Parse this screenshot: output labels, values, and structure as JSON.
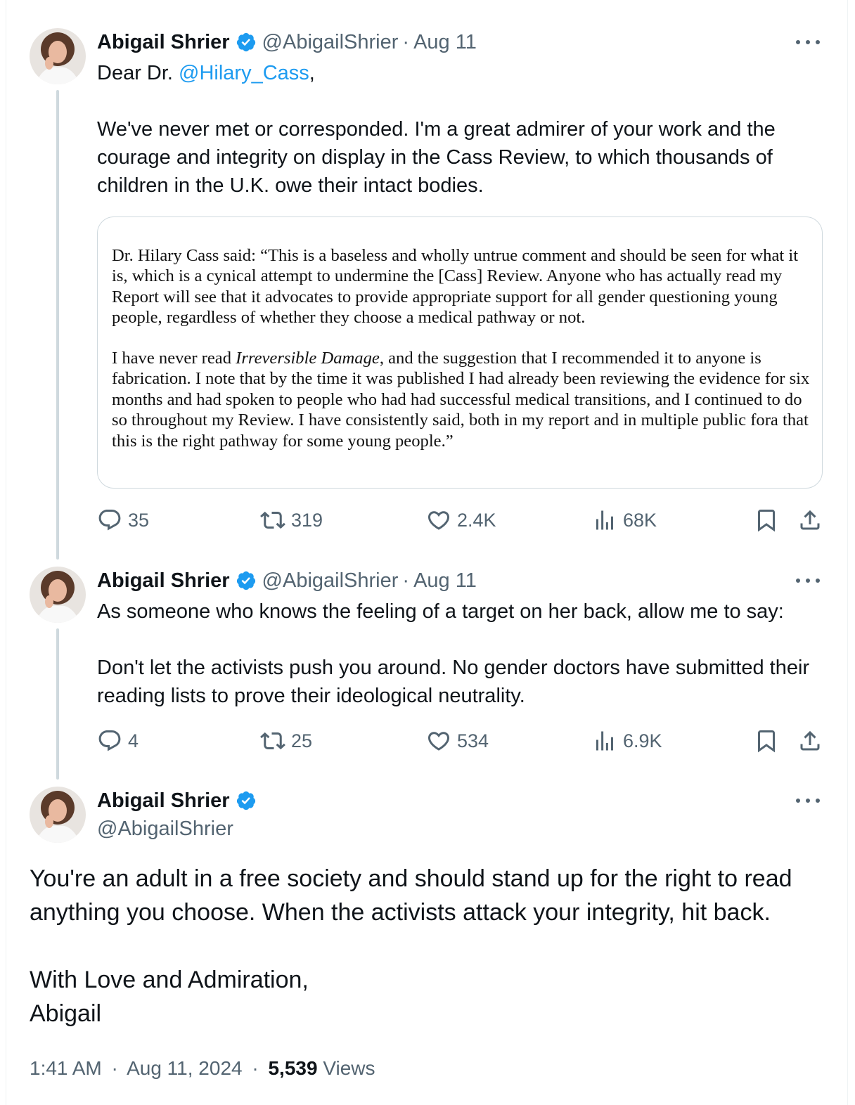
{
  "tweets": [
    {
      "name": "Abigail Shrier",
      "handle": "@AbigailShrier",
      "date": "Aug 11",
      "text_prefix": "Dear Dr. ",
      "mention": "@Hilary_Cass",
      "text_after_mention": ",",
      "text_body": "We've never met or corresponded. I'm a great admirer of your work and the courage and integrity on display in the Cass Review, to which thousands of children in the U.K. owe their intact bodies.",
      "quote": {
        "para1": "Dr. Hilary Cass said: “This is a baseless and wholly untrue comment and should be seen for what it is, which is a cynical attempt to undermine the [Cass] Review. Anyone who has actually read my Report will see that it advocates to provide appropriate support for all gender questioning young people, regardless of whether they choose a medical pathway or not.",
        "para2_before": "I have never read ",
        "para2_italic": "Irreversible Damage",
        "para2_after": ", and the suggestion that I recommended it to anyone is fabrication. I note that by the time it was published I had already been reviewing the evidence for six months and had spoken to people who had had successful medical transitions, and I continued to do so throughout my Review. I have consistently said, both in my report and in multiple public fora that this is the right pathway for some young people.”"
      },
      "stats": {
        "replies": "35",
        "reposts": "319",
        "likes": "2.4K",
        "views": "68K"
      }
    },
    {
      "name": "Abigail Shrier",
      "handle": "@AbigailShrier",
      "date": "Aug 11",
      "text_line1": "As someone who knows the feeling of a target on her back, allow me to say:",
      "text_body": "Don't let the activists push you around. No gender doctors have submitted their reading lists to prove their ideological neutrality.",
      "stats": {
        "replies": "4",
        "reposts": "25",
        "likes": "534",
        "views": "6.9K"
      }
    }
  ],
  "main_tweet": {
    "name": "Abigail Shrier",
    "handle": "@AbigailShrier",
    "text": "You're an adult in a free society and should stand up for the right to read anything you choose. When the activists attack your integrity, hit back.\n\nWith Love and Admiration,\nAbigail",
    "time": "1:41 AM",
    "date": "Aug 11, 2024",
    "views_count": "5,539",
    "views_label": "Views"
  },
  "separator": "·",
  "colors": {
    "text": "#0f1419",
    "secondary": "#536471",
    "link": "#1d9bf0",
    "verified": "#1d9bf0",
    "border": "#cfd9de"
  },
  "icons": [
    "verified-badge-icon",
    "more-icon",
    "reply-icon",
    "repost-icon",
    "like-icon",
    "views-icon",
    "bookmark-icon",
    "share-icon"
  ]
}
